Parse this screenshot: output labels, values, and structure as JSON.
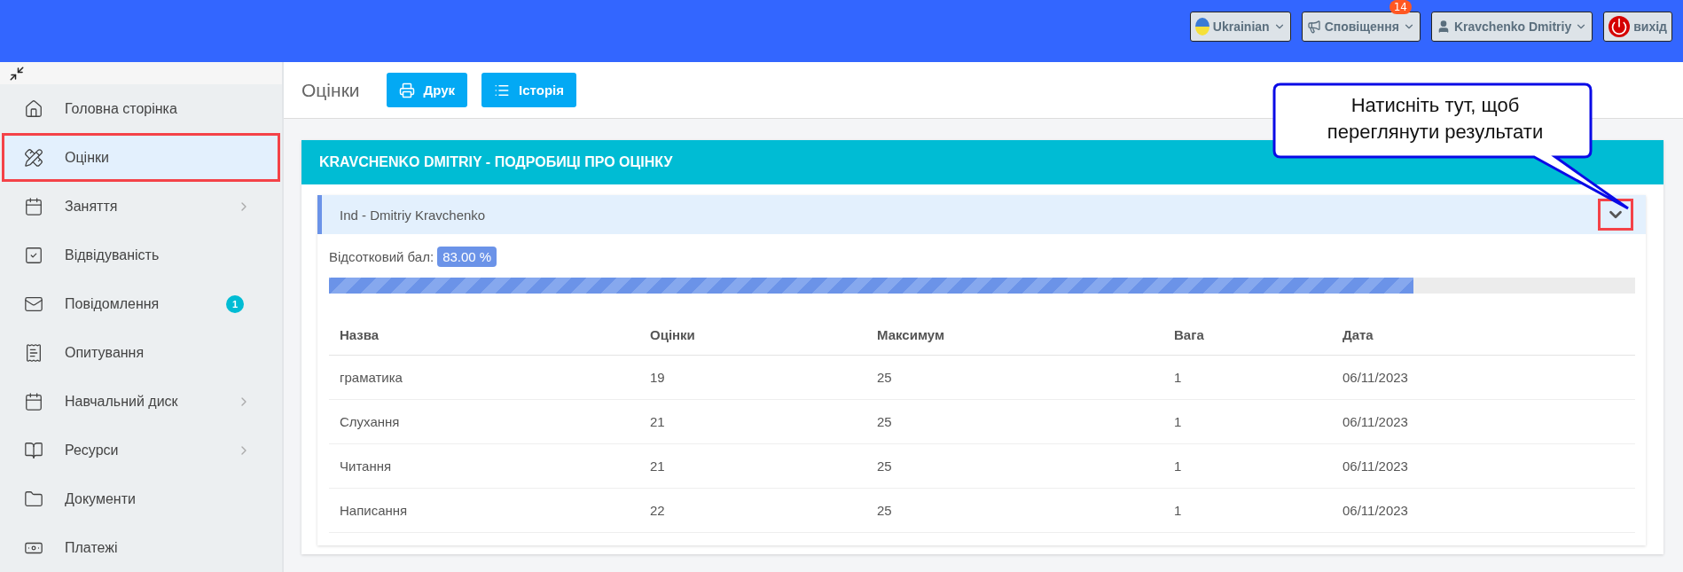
{
  "top_bar": {
    "language": "Ukrainian",
    "notifications": {
      "label": "Сповіщення",
      "count": "14"
    },
    "user": "Kravchenko Dmitriy",
    "logout": "вихід"
  },
  "sidebar": {
    "items": [
      {
        "label": "Головна сторінка",
        "selected": false,
        "has_submenu": false
      },
      {
        "label": "Оцінки",
        "selected": true,
        "has_submenu": false,
        "annotated": true
      },
      {
        "label": "Заняття",
        "selected": false,
        "has_submenu": true
      },
      {
        "label": "Відвідуваність",
        "selected": false,
        "has_submenu": false
      },
      {
        "label": "Повідомлення",
        "selected": false,
        "has_submenu": false,
        "badge": "1"
      },
      {
        "label": "Опитування",
        "selected": false,
        "has_submenu": false
      },
      {
        "label": "Навчальний диск",
        "selected": false,
        "has_submenu": true
      },
      {
        "label": "Ресурси",
        "selected": false,
        "has_submenu": true
      },
      {
        "label": "Документи",
        "selected": false,
        "has_submenu": false
      },
      {
        "label": "Платежі",
        "selected": false,
        "has_submenu": false
      }
    ]
  },
  "page": {
    "title": "Оцінки",
    "buttons": [
      "Друк",
      "Історія"
    ]
  },
  "card": {
    "title": "KRAVCHENKO DMITRIY - ПОДРОБИЦІ ПРО ОЦІНКУ",
    "group": {
      "title": "Ind - Dmitriy Kravchenko",
      "expanded": true,
      "annotated": true
    },
    "score_label": "Відсотковий бал:",
    "score": "83.00 %",
    "level": 0.83,
    "table": {
      "columns": [
        "Назва",
        "Оцінки",
        "Максимум",
        "Вага",
        "Дата"
      ],
      "rows": [
        [
          "граматика",
          "19",
          "25",
          "1",
          "06/11/2023"
        ],
        [
          "Слухання",
          "21",
          "25",
          "1",
          "06/11/2023"
        ],
        [
          "Читання",
          "21",
          "25",
          "1",
          "06/11/2023"
        ],
        [
          "Написання",
          "22",
          "25",
          "1",
          "06/11/2023"
        ]
      ]
    }
  },
  "callout": {
    "text": "Натисніть тут, щоб переглянути результати"
  }
}
